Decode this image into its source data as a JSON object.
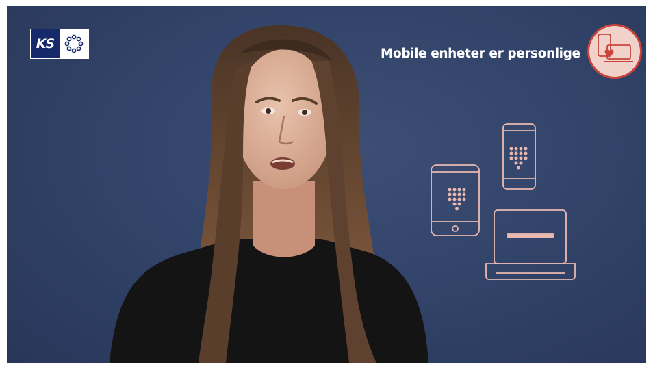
{
  "logo": {
    "text": "KS"
  },
  "title": "Mobile enheter er personlige",
  "colors": {
    "background": "#33446a",
    "accent_line": "#e9b9b1",
    "badge_fill": "#f0d2cb",
    "badge_ring": "#c9443a",
    "heart": "#c9443a"
  },
  "icons": [
    "ks-logo-icon",
    "ring-logo-icon",
    "phone-heart-badge-icon",
    "tablet-icon",
    "smartphone-icon",
    "laptop-icon"
  ]
}
